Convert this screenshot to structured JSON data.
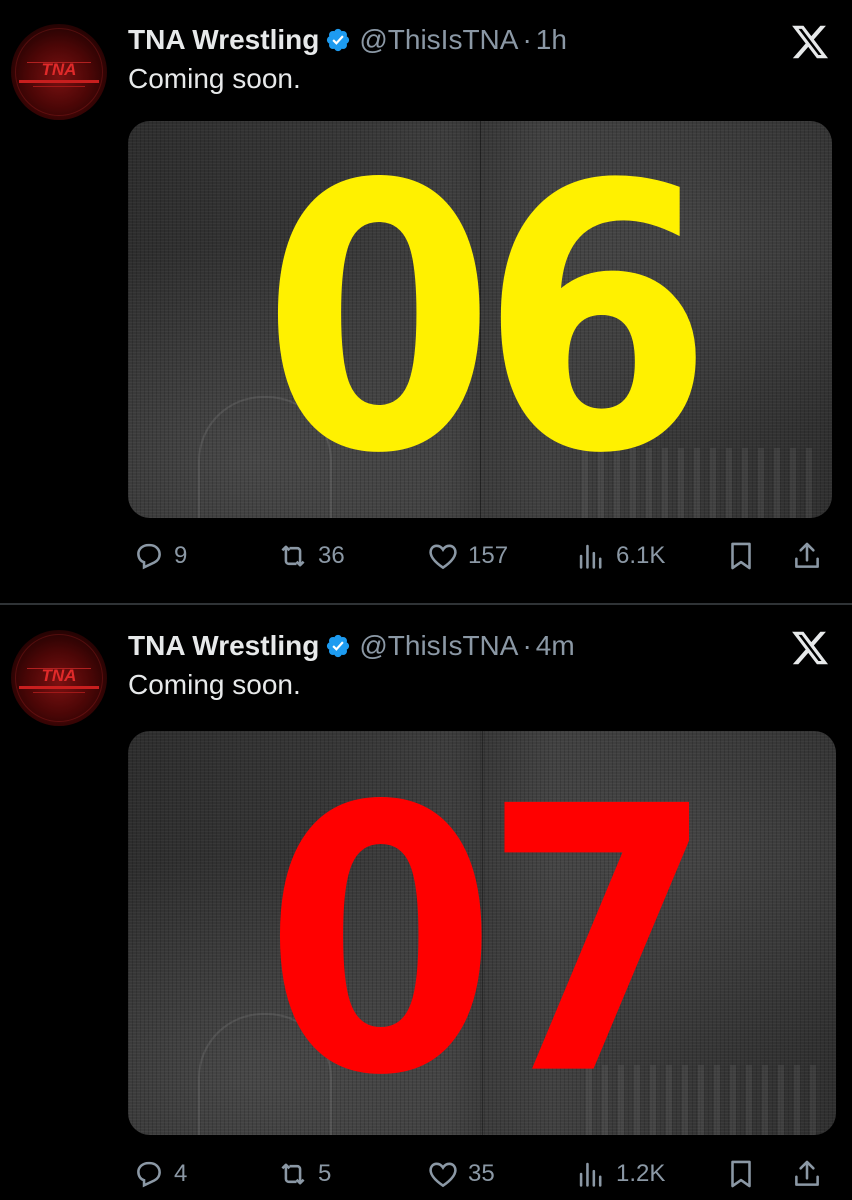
{
  "tweets": [
    {
      "author": {
        "name": "TNA Wrestling",
        "handle": "@ThisIsTNA",
        "separator": "·",
        "time": "1h",
        "avatar_logo": "TNA"
      },
      "text": "Coming soon.",
      "media": {
        "number": "06",
        "number_color": "#fff100"
      },
      "stats": {
        "replies": "9",
        "retweets": "36",
        "likes": "157",
        "views": "6.1K"
      }
    },
    {
      "author": {
        "name": "TNA Wrestling",
        "handle": "@ThisIsTNA",
        "separator": "·",
        "time": "4m",
        "avatar_logo": "TNA"
      },
      "text": "Coming soon.",
      "media": {
        "number": "07",
        "number_color": "#ff0000"
      },
      "stats": {
        "replies": "4",
        "retweets": "5",
        "likes": "35",
        "views": "1.2K"
      }
    }
  ],
  "colors": {
    "background": "#000000",
    "text": "#e7e9ea",
    "muted": "#8b98a5",
    "verified": "#1d9bf0"
  },
  "icons": [
    "verified-badge-icon",
    "x-logo-icon",
    "reply-icon",
    "retweet-icon",
    "like-icon",
    "views-icon",
    "bookmark-icon",
    "share-icon"
  ]
}
